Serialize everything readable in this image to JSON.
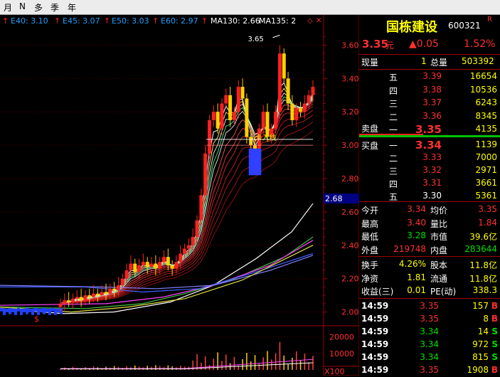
{
  "tabs": [
    "月",
    "N",
    "多",
    "季",
    "年"
  ],
  "ma_legend": [
    {
      "label": "E40: 3.10",
      "color": "#20a0ff"
    },
    {
      "label": "E45: 3.07",
      "color": "#20a0ff"
    },
    {
      "label": "E50: 3.03",
      "color": "#20a0ff"
    },
    {
      "label": "E60: 2.97",
      "color": "#20a0ff"
    },
    {
      "label": "MA130: 2.66",
      "color": "#ffffff"
    },
    {
      "label": "MA135: 2",
      "color": "#ffffff"
    }
  ],
  "stock": {
    "name": "国栋建设",
    "code": "600321",
    "marker": "R",
    "price": "3.35",
    "price_unit": "元",
    "change": "▲0.05",
    "change_pct": "1.52%",
    "current_vol_label": "现量",
    "current_vol": "1",
    "total_vol_label": "总量",
    "total_vol": "503392"
  },
  "sell_label": "卖盘",
  "buy_label": "买盘",
  "asks": [
    {
      "level": "五",
      "price": "3.39",
      "vol": "16654"
    },
    {
      "level": "四",
      "price": "3.38",
      "vol": "10536"
    },
    {
      "level": "三",
      "price": "3.37",
      "vol": "6243"
    },
    {
      "level": "二",
      "price": "3.36",
      "vol": "8345"
    },
    {
      "level": "一",
      "price": "3.35",
      "vol": "4135"
    }
  ],
  "bids": [
    {
      "level": "一",
      "price": "3.34",
      "vol": "1139"
    },
    {
      "level": "二",
      "price": "3.33",
      "vol": "7000"
    },
    {
      "level": "三",
      "price": "3.32",
      "vol": "2971"
    },
    {
      "level": "四",
      "price": "3.31",
      "vol": "3661"
    },
    {
      "level": "五",
      "price": "3.30",
      "vol": "5361"
    }
  ],
  "stats": [
    {
      "l1": "今开",
      "v1": "3.34",
      "l2": "均价",
      "v2": "3.35"
    },
    {
      "l1": "最高",
      "v1": "3.40",
      "l2": "量比",
      "v2": "1.84"
    },
    {
      "l1": "最低",
      "v1": "3.28",
      "l2": "市值",
      "v2": "39.6亿"
    },
    {
      "l1": "外盘",
      "v1": "219748",
      "l2": "内盘",
      "v2": "283644"
    }
  ],
  "stats2": [
    {
      "l1": "换手",
      "v1": "4.26%",
      "l2": "股本",
      "v2": "11.8亿"
    },
    {
      "l1": "净资",
      "v1": "1.81",
      "l2": "流通",
      "v2": "11.8亿"
    },
    {
      "l1": "收益(三)",
      "v1": "0.01",
      "l2": "PE(动)",
      "v2": "338.3"
    }
  ],
  "trades": [
    {
      "time": "14:59",
      "price": "3.35",
      "vol": "157",
      "side": "B"
    },
    {
      "time": "14:59",
      "price": "3.35",
      "vol": "8",
      "side": "B"
    },
    {
      "time": "14:59",
      "price": "3.34",
      "vol": "14",
      "side": "S"
    },
    {
      "time": "14:59",
      "price": "3.34",
      "vol": "972",
      "side": "S"
    },
    {
      "time": "14:59",
      "price": "3.34",
      "vol": "815",
      "side": "S"
    },
    {
      "time": "14:59",
      "price": "3.35",
      "vol": "1908",
      "side": "B"
    }
  ],
  "chart_data": {
    "type": "candlestick",
    "y_ticks": [
      3.6,
      3.4,
      3.2,
      3.0,
      2.8,
      2.6,
      2.4,
      2.2,
      2.0
    ],
    "ylim": [
      1.93,
      3.7
    ],
    "current_price_label": "2.68",
    "high_label": "3.65",
    "annotation": "卡入线",
    "ma_values": {
      "E40": 3.1,
      "E45": 3.07,
      "E50": 3.03,
      "E60": 2.97,
      "MA130": 2.66
    },
    "volume_ticks": [
      20000,
      10000
    ],
    "volume_unit": "X100",
    "candles_close": [
      2.05,
      2.07,
      2.06,
      2.08,
      2.09,
      2.07,
      2.1,
      2.09,
      2.11,
      2.1,
      2.12,
      2.11,
      2.14,
      2.13,
      2.16,
      2.2,
      2.25,
      2.29,
      2.24,
      2.28,
      2.3,
      2.27,
      2.29,
      2.26,
      2.3,
      2.33,
      2.28,
      2.26,
      2.3,
      2.35,
      2.38,
      2.4,
      2.45,
      2.55,
      2.7,
      2.95,
      3.15,
      3.2,
      3.1,
      3.25,
      3.3,
      3.15,
      3.2,
      3.35,
      3.28,
      3.05,
      3.0,
      2.9,
      3.1,
      3.2,
      3.05,
      3.1,
      3.2,
      3.55,
      3.4,
      3.25,
      3.15,
      3.22,
      3.2,
      3.25,
      3.3,
      3.35
    ]
  }
}
